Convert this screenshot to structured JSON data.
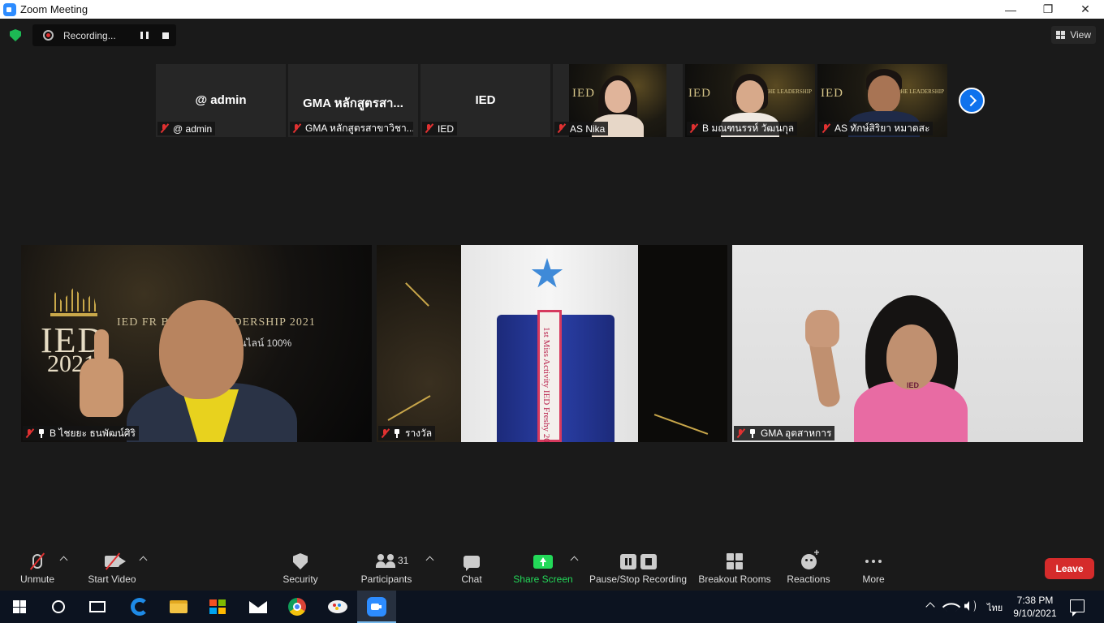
{
  "window": {
    "title": "Zoom Meeting",
    "minimize": "—",
    "restore": "❐",
    "close": "✕"
  },
  "recording": {
    "label": "Recording..."
  },
  "view_button": {
    "label": "View"
  },
  "gallery_strip": [
    {
      "center_name": "@ admin",
      "tag": "@ admin",
      "video": false
    },
    {
      "center_name": "GMA หลักสูตรสา...",
      "tag": "GMA หลักสูตรสาขาวิชา...",
      "video": false
    },
    {
      "center_name": "IED",
      "tag": "IED",
      "video": false
    },
    {
      "center_name": "",
      "tag": "AS Nika",
      "video": true
    },
    {
      "center_name": "",
      "tag": "B มณฑนรรห์ วัฒนกุล",
      "video": true
    },
    {
      "center_name": "",
      "tag": "AS ทักษ์สิริยา หมาดสะ",
      "video": true
    }
  ],
  "main_tiles": [
    {
      "tag": "B ไชยยะ ธนพัฒน์ศิริ",
      "bg_title": "IED",
      "bg_year": "2021",
      "bg_headline": "IED FR          BE THE LEADERSHIP 2021",
      "bg_sub": "แบบออนไลน์ 100%"
    },
    {
      "tag": "รางวัล",
      "sash_text": "1st Miss Activity IED Freshy 2021"
    },
    {
      "tag": "GMA อุตสาหการ",
      "shirt_logo": "IED"
    }
  ],
  "strip_video_text": {
    "title": "IED",
    "year": "2021",
    "small": "BE THE LEADERSHIP"
  },
  "toolbar": {
    "unmute": "Unmute",
    "start_video": "Start Video",
    "security": "Security",
    "participants": "Participants",
    "participants_count": "31",
    "chat": "Chat",
    "share_screen": "Share Screen",
    "pause_stop_recording": "Pause/Stop Recording",
    "breakout_rooms": "Breakout Rooms",
    "reactions": "Reactions",
    "more": "More",
    "leave": "Leave"
  },
  "colors": {
    "share_green": "#23d959",
    "leave_red": "#d52b2b",
    "next_blue": "#0e72ed"
  },
  "taskbar": {
    "language": "ไทย",
    "time": "7:38 PM",
    "date": "9/10/2021"
  }
}
